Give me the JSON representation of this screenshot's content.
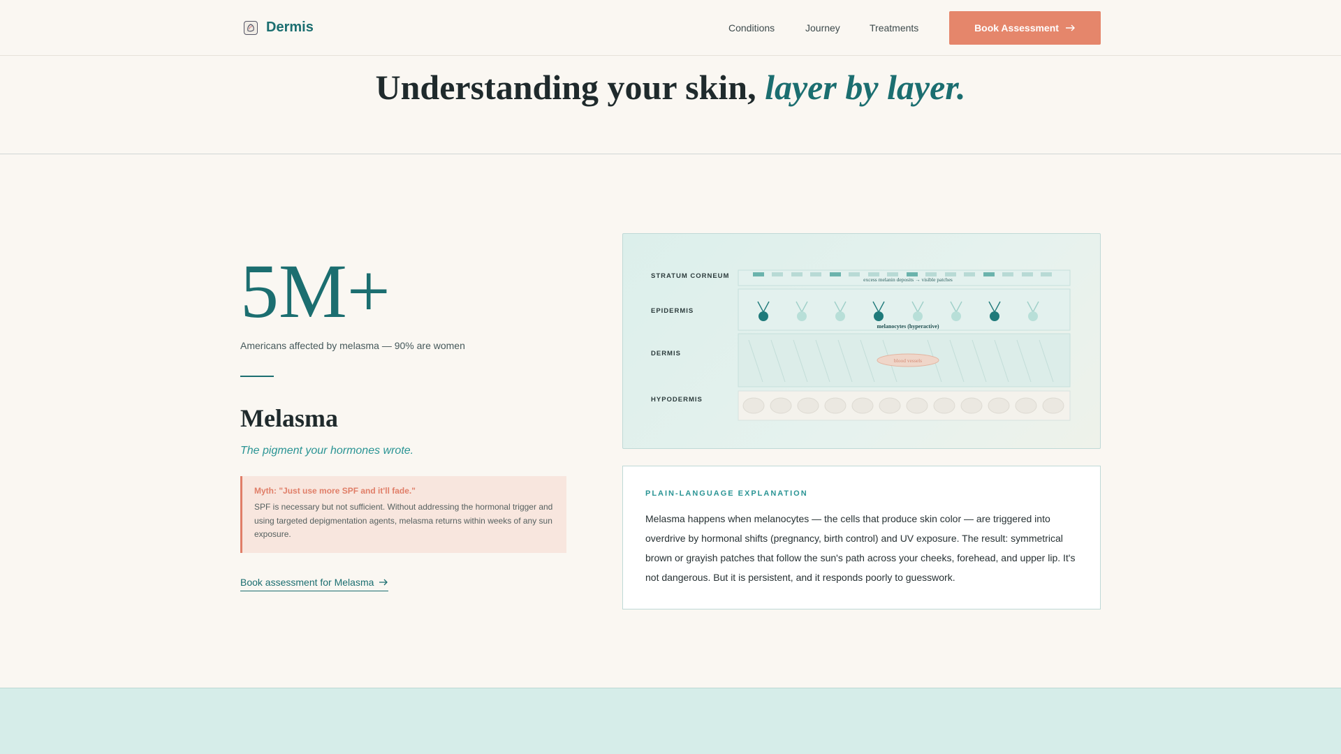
{
  "nav": {
    "brand": "Dermis",
    "links": [
      "Conditions",
      "Journey",
      "Treatments"
    ],
    "cta_label": "Book Assessment"
  },
  "hero": {
    "title_plain": "Understanding your skin, ",
    "title_em": "layer by layer."
  },
  "condition": {
    "stat": "5M+",
    "stat_label": "Americans affected by melasma — 90% are women",
    "name": "Melasma",
    "tagline": "The pigment your hormones wrote.",
    "myth_title": "Myth: \"Just use more SPF and it'll fade.\"",
    "myth_body": "SPF is necessary but not sufficient. Without addressing the hormonal trigger and using targeted depigmentation agents, melasma returns within weeks of any sun exposure.",
    "book_link": "Book assessment for Melasma"
  },
  "diagram": {
    "layers": [
      "STRATUM CORNEUM",
      "EPIDERMIS",
      "DERMIS",
      "HYPODERMIS"
    ],
    "note_corneum": "excess melanin deposits → visible patches",
    "note_epidermis": "melanocytes (hyperactive)",
    "note_dermis": "blood vessels"
  },
  "explanation": {
    "label": "PLAIN-LANGUAGE EXPLANATION",
    "body": "Melasma happens when melanocytes — the cells that produce skin color — are triggered into overdrive by hormonal shifts (pregnancy, birth control) and UV exposure. The result: symmetrical brown or grayish patches that follow the sun's path across your cheeks, forehead, and upper lip. It's not dangerous. But it is persistent, and it responds poorly to guesswork."
  },
  "colors": {
    "background": "#faf7f2",
    "teal": "#1b6e70",
    "coral": "#e5866b",
    "myth_bg": "#f8e6de"
  }
}
